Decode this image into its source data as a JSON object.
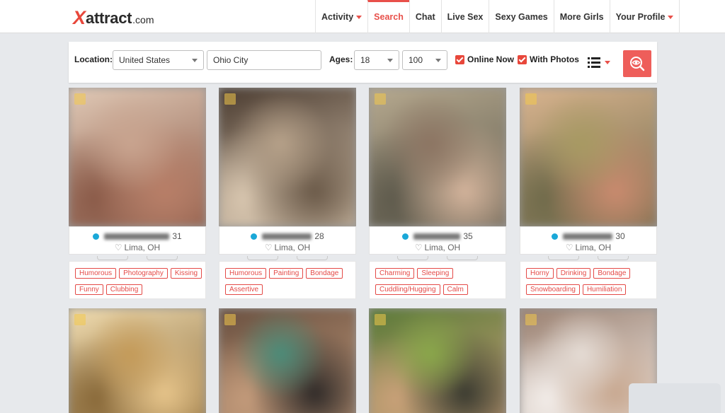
{
  "header": {
    "logo": {
      "x": "X",
      "main": "attract",
      "tld": ".com"
    },
    "nav": [
      {
        "label": "Activity",
        "caret": true,
        "active": false
      },
      {
        "label": "Search",
        "caret": false,
        "active": true
      },
      {
        "label": "Chat",
        "caret": false,
        "active": false
      },
      {
        "label": "Live Sex",
        "caret": false,
        "active": false
      },
      {
        "label": "Sexy Games",
        "caret": false,
        "active": false
      },
      {
        "label": "More Girls",
        "caret": false,
        "active": false
      },
      {
        "label": "Your Profile",
        "caret": true,
        "active": false
      }
    ]
  },
  "filters": {
    "location_label": "Location:",
    "country": "United States",
    "city": "Ohio City",
    "ages_label": "Ages:",
    "age_min": "18",
    "age_max": "100",
    "online_now": "Online Now",
    "with_photos": "With Photos"
  },
  "colors": {
    "accent": "#e8504a",
    "online": "#1aa8d8",
    "tag": "#e44a47"
  },
  "icons": {
    "search": "search-eye-icon",
    "list": "list-view-icon"
  },
  "profiles": [
    {
      "age": "31",
      "location": "Lima, OH",
      "tags": [
        "Humorous",
        "Photography",
        "Kissing",
        "Funny",
        "Clubbing"
      ],
      "photo_colors": [
        "#c9a48f",
        "#b87e67",
        "#8a5a48",
        "#e0c9b6"
      ]
    },
    {
      "age": "28",
      "location": "Lima, OH",
      "tags": [
        "Humorous",
        "Painting",
        "Bondage",
        "Assertive"
      ],
      "photo_colors": [
        "#b7a28a",
        "#6b5a49",
        "#d9c7b0",
        "#4a3b30"
      ]
    },
    {
      "age": "35",
      "location": "Lima, OH",
      "tags": [
        "Charming",
        "Sleeping",
        "Cuddling/Hugging",
        "Calm"
      ],
      "photo_colors": [
        "#8c7462",
        "#d3b39b",
        "#5e5a4c",
        "#b6a98f"
      ]
    },
    {
      "age": "30",
      "location": "Lima, OH",
      "tags": [
        "Horny",
        "Drinking",
        "Bondage",
        "Snowboarding",
        "Humiliation"
      ],
      "photo_colors": [
        "#a79a62",
        "#c98a6e",
        "#6f6a4a",
        "#d9b48f"
      ]
    }
  ],
  "bottom_photos": [
    {
      "photo_colors": [
        "#c49a58",
        "#e6c48a",
        "#8a6a3a",
        "#f0dcb0"
      ]
    },
    {
      "photo_colors": [
        "#4a8d7a",
        "#2f2a28",
        "#c29a7a",
        "#6a5040"
      ]
    },
    {
      "photo_colors": [
        "#8aa84a",
        "#3a3a30",
        "#c8a078",
        "#5a7a38"
      ]
    },
    {
      "photo_colors": [
        "#e6ddd6",
        "#c8a890",
        "#f2ece8",
        "#9a8070"
      ]
    }
  ]
}
